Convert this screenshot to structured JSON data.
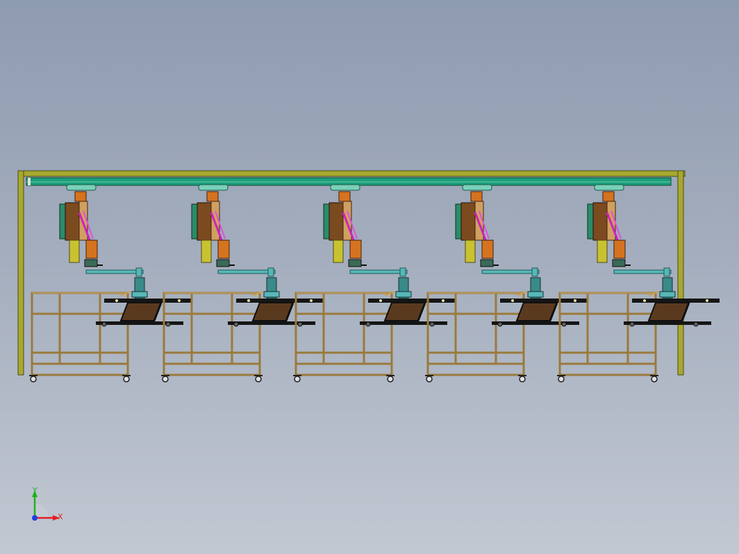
{
  "triad": {
    "x_label": "X",
    "y_label": "Y"
  },
  "colors": {
    "background_top": "#8e9bb0",
    "background_bottom": "#c2c8d2",
    "gantry_frame": "#a8a830",
    "gantry_beam": "#1d9e7a",
    "cart_frame": "#9a7a3c",
    "conveyor": "#151515",
    "tray": "#5a3a1e",
    "robot_orange": "#d5731e",
    "robot_brown": "#7c4a1f",
    "robot_green": "#2a8c6a",
    "robot_yellow": "#c9c230",
    "robot_magenta": "#d020c0",
    "gripper_cyan": "#58b7b7",
    "axis_x": "#e02020",
    "axis_y": "#20b020",
    "axis_z": "#2040e0"
  },
  "stations": [
    {
      "id": "station-1"
    },
    {
      "id": "station-2"
    },
    {
      "id": "station-3"
    },
    {
      "id": "station-4"
    },
    {
      "id": "station-5"
    }
  ]
}
